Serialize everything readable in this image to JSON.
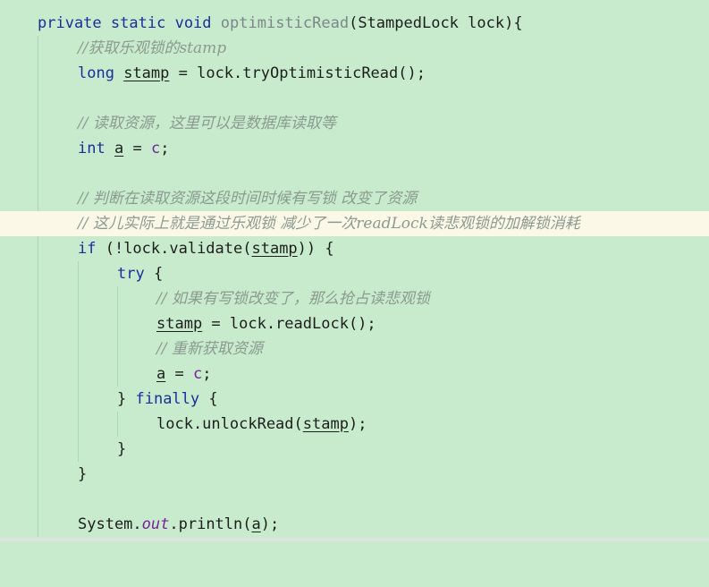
{
  "code": {
    "l1": {
      "mod1": "private",
      "mod2": "static",
      "ret": "void",
      "name": "optimisticRead",
      "open": "(",
      "ptype": "StampedLock",
      "pname": "lock",
      "close": "){"
    },
    "l2": {
      "comment": "//获取乐观锁的stamp"
    },
    "l3": {
      "type": "long",
      "var": "stamp",
      "rest": " = lock.tryOptimisticRead();"
    },
    "l5": {
      "comment": "// 读取资源，这里可以是数据库读取等"
    },
    "l6": {
      "type": "int",
      "var": "a",
      "eq": " = ",
      "field": "c",
      "end": ";"
    },
    "l8": {
      "comment": "// 判断在读取资源这段时间时候有写锁 改变了资源"
    },
    "l9": {
      "comment": "// 这儿实际上就是通过乐观锁 减少了一次readLock读悲观锁的加解锁消耗"
    },
    "l10": {
      "kw": "if",
      "pre": " (!lock.validate(",
      "var": "stamp",
      "post": ")) {"
    },
    "l11": {
      "kw": "try",
      "post": " {"
    },
    "l12": {
      "comment": "// 如果有写锁改变了，那么抢占读悲观锁"
    },
    "l13": {
      "var": "stamp",
      "rest": " = lock.readLock();"
    },
    "l14": {
      "comment": "// 重新获取资源"
    },
    "l15": {
      "var": "a",
      "eq": " = ",
      "field": "c",
      "end": ";"
    },
    "l16": {
      "pre": "} ",
      "kw": "finally",
      "post": " {"
    },
    "l17": {
      "pre": "lock.unlockRead(",
      "var": "stamp",
      "post": ");"
    },
    "l18": {
      "text": "}"
    },
    "l19": {
      "text": "}"
    },
    "l21": {
      "pre": "System.",
      "field": "out",
      "mid": ".println(",
      "var": "a",
      "post": ");"
    }
  },
  "colors": {
    "background": "#c7ebcc",
    "current_line": "#fbf8e8",
    "keyword": "#1a2e9e",
    "comment": "#8c9a91",
    "field": "#7b1f9e"
  }
}
